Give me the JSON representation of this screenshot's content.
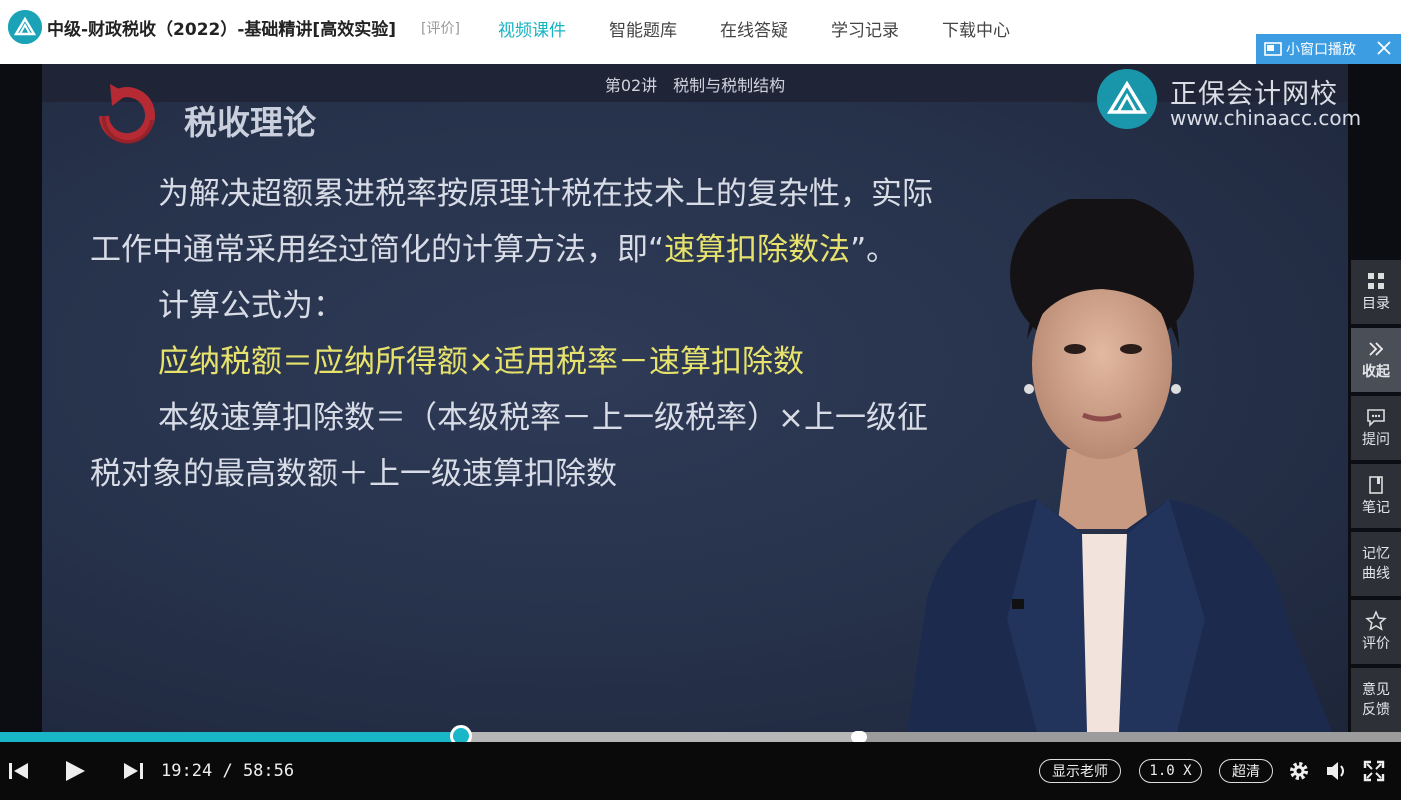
{
  "header": {
    "course_title": "中级-财政税收（2022）-基础精讲[高效实验]",
    "rate_link": "[评价]",
    "nav": [
      {
        "label": "视频课件",
        "active": true
      },
      {
        "label": "智能题库",
        "active": false
      },
      {
        "label": "在线答疑",
        "active": false
      },
      {
        "label": "学习记录",
        "active": false
      },
      {
        "label": "下载中心",
        "active": false
      }
    ],
    "mini_player_label": "小窗口播放"
  },
  "slide": {
    "lecture": "第02讲　税制与税制结构",
    "title": "税收理论",
    "brand_cn": "正保会计网校",
    "brand_url": "www.chinaacc.com",
    "line1": "为解决超额累进税率按原理计税在技术上的复杂性，实际",
    "line2_a": "工作中通常采用经过简化的计算方法，即“",
    "line2_hl": "速算扣除数法",
    "line2_b": "”。",
    "line3": "计算公式为：",
    "line4": "应纳税额＝应纳所得额×适用税率－速算扣除数",
    "line5": "本级速算扣除数＝（本级税率－上一级税率）×上一级征",
    "line6": "税对象的最高数额＋上一级速算扣除数"
  },
  "side_panel": [
    {
      "label": "目录",
      "icon": "grid-icon"
    },
    {
      "label": "收起",
      "icon": "double-chevron-right-icon",
      "active": true
    },
    {
      "label": "提问",
      "icon": "chat-icon"
    },
    {
      "label": "笔记",
      "icon": "note-icon"
    },
    {
      "label": "记忆曲线",
      "line1": "记忆",
      "line2": "曲线"
    },
    {
      "label": "评价",
      "icon": "star-icon"
    },
    {
      "label": "意见反馈",
      "line1": "意见",
      "line2": "反馈"
    }
  ],
  "player": {
    "current_time": "19:24",
    "separator": "/",
    "duration": "58:56",
    "played_fraction": 0.329,
    "buffered_fraction": 0.613,
    "show_teacher_label": "显示老师",
    "speed_label": "1.0 X",
    "quality_label": "超清"
  },
  "colors": {
    "accent": "#16b3c4",
    "mini_player_bg": "#3c9de3",
    "highlight_text": "#e6e26b"
  }
}
